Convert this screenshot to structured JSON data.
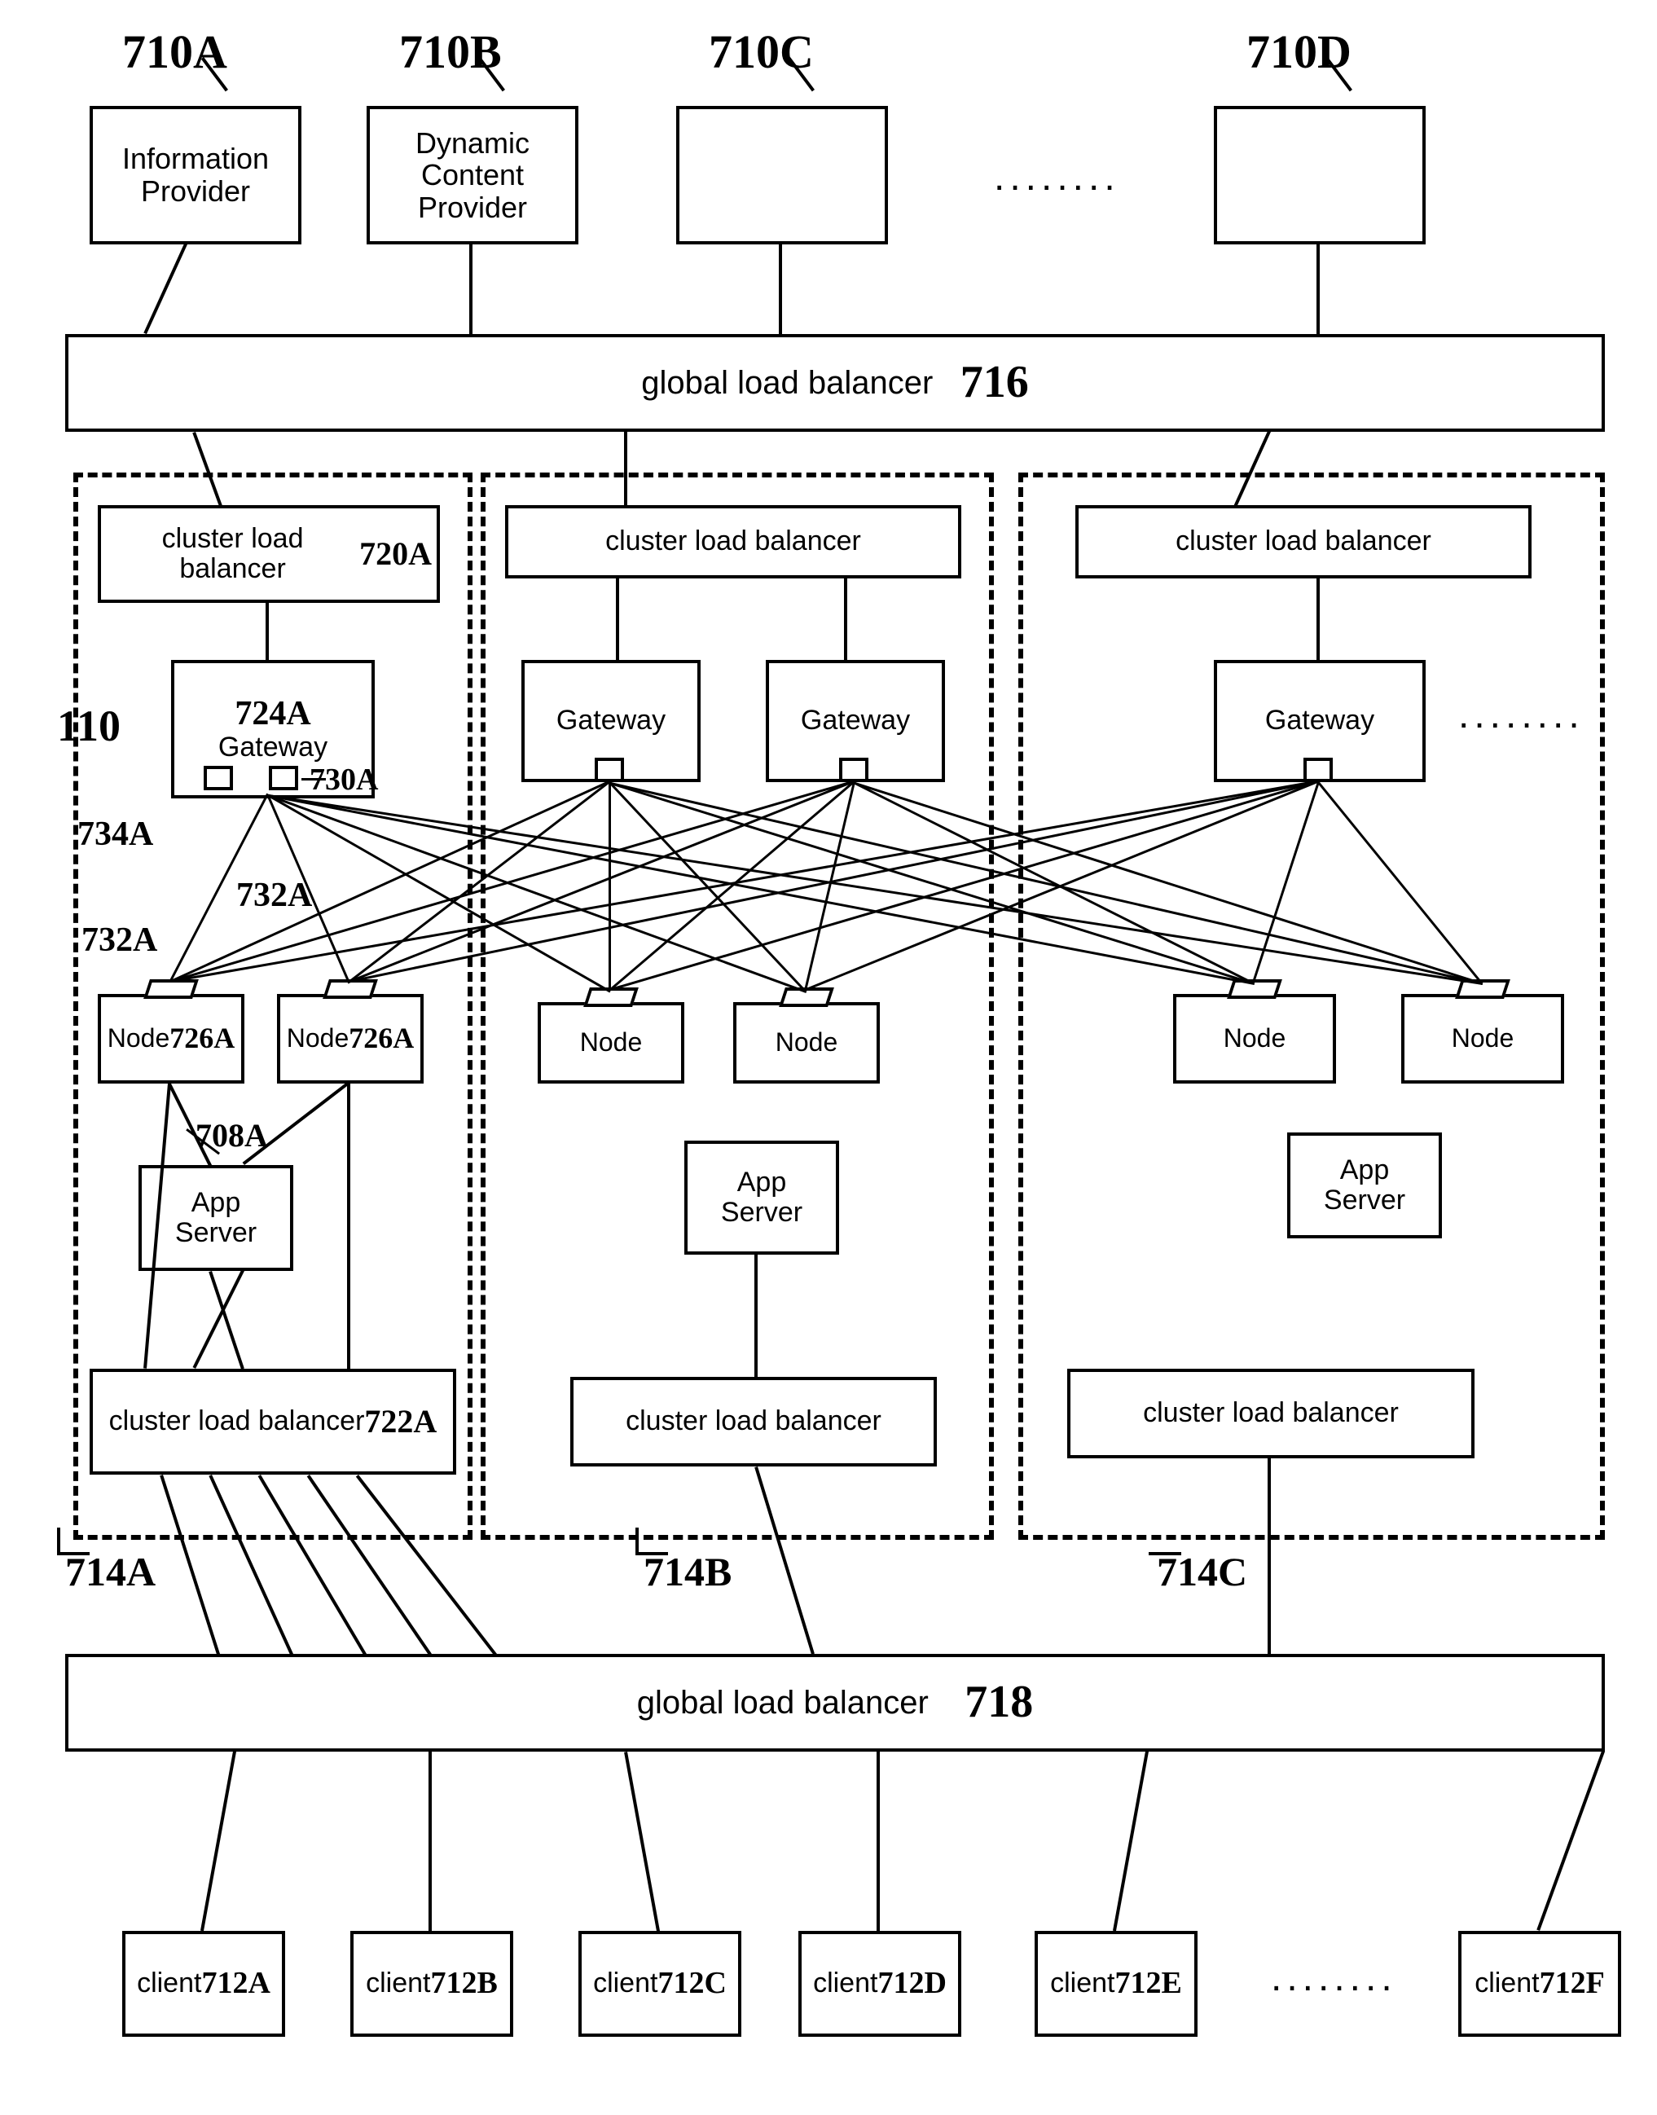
{
  "providers": [
    {
      "ref": "710A",
      "label": "Information\nProvider"
    },
    {
      "ref": "710B",
      "label": "Dynamic\nContent\nProvider"
    },
    {
      "ref": "710C",
      "label": ""
    },
    {
      "ref": "710D",
      "label": ""
    }
  ],
  "dots_top": "........",
  "dots_right_gw": "........",
  "dots_clients": "........",
  "glb_top": {
    "label": "global load balancer",
    "ref": "716"
  },
  "glb_bot": {
    "label": "global load balancer",
    "ref": "718"
  },
  "clusters": [
    {
      "id": "A",
      "ref": "714A",
      "clb_top": {
        "label": "cluster load balancer",
        "ref": "720A"
      },
      "gateways": [
        {
          "label": "Gateway",
          "top_ref": "724A",
          "port_ref": "730A"
        }
      ],
      "nodes": [
        {
          "label": "Node",
          "ref": "726A"
        },
        {
          "label": "Node",
          "ref": "726A"
        }
      ],
      "app": {
        "label": "App\nServer",
        "ref": "708A"
      },
      "clb_bot": {
        "label": "cluster load balancer",
        "ref": "722A"
      },
      "extra_refs": {
        "cluster_left": "110",
        "gw_left_port": "734A",
        "edge_a": "732A",
        "edge_b": "732A"
      }
    },
    {
      "id": "B",
      "ref": "714B",
      "clb_top": {
        "label": "cluster load balancer"
      },
      "gateways": [
        {
          "label": "Gateway"
        },
        {
          "label": "Gateway"
        }
      ],
      "nodes": [
        {
          "label": "Node"
        },
        {
          "label": "Node"
        }
      ],
      "app": {
        "label": "App\nServer"
      },
      "clb_bot": {
        "label": "cluster load balancer"
      }
    },
    {
      "id": "C",
      "ref": "714C",
      "clb_top": {
        "label": "cluster load balancer"
      },
      "gateways": [
        {
          "label": "Gateway"
        }
      ],
      "nodes": [
        {
          "label": "Node"
        },
        {
          "label": "Node"
        }
      ],
      "app": {
        "label": "App\nServer"
      },
      "clb_bot": {
        "label": "cluster load balancer"
      }
    }
  ],
  "clients": [
    {
      "label": "client",
      "ref": "712A"
    },
    {
      "label": "client",
      "ref": "712B"
    },
    {
      "label": "client",
      "ref": "712C"
    },
    {
      "label": "client",
      "ref": "712D"
    },
    {
      "label": "client",
      "ref": "712E"
    },
    {
      "label": "client",
      "ref": "712F"
    }
  ]
}
